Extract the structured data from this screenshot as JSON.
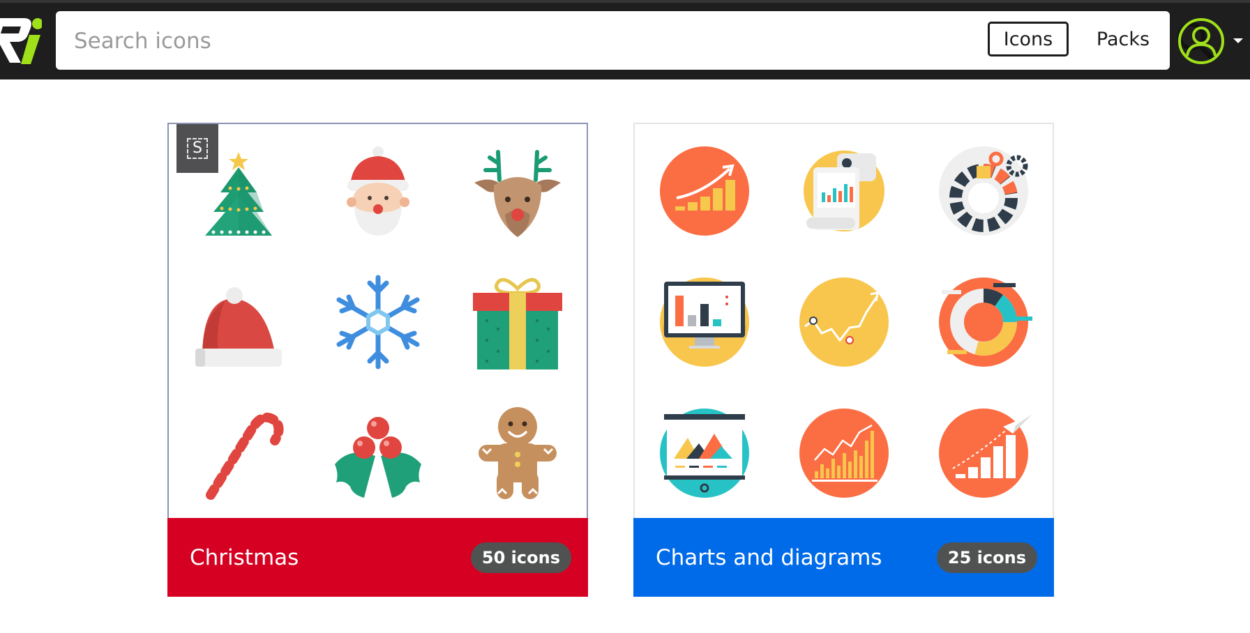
{
  "header": {
    "search_placeholder": "Search icons",
    "search_value": "",
    "icons_tab_label": "Icons",
    "packs_tab_label": "Packs",
    "search_icon": "magnifier-icon",
    "avatar_icon": "user-circle-icon",
    "logo_icon": "brand-logo-icon"
  },
  "colors": {
    "header_bg": "#1e1e1e",
    "christmas_footer": "#d60022",
    "charts_footer": "#006be8",
    "avatar_accent": "#9fe01a",
    "count_badge": "#505252"
  },
  "packs": [
    {
      "title": "Christmas",
      "count": "50 icons",
      "style_badge": "S",
      "icons": [
        "christmas-tree-icon",
        "santa-claus-icon",
        "reindeer-icon",
        "santa-hat-icon",
        "snowflake-icon",
        "gift-box-icon",
        "candy-cane-icon",
        "holly-berries-icon",
        "gingerbread-man-icon"
      ]
    },
    {
      "title": "Charts and diagrams",
      "count": "25 icons",
      "icons": [
        "growth-bars-icon",
        "report-documents-icon",
        "settings-gears-icon",
        "monitor-chart-icon",
        "line-graph-icon",
        "donut-chart-icon",
        "presentation-board-icon",
        "bar-line-chart-icon",
        "paper-plane-chart-icon"
      ]
    }
  ]
}
